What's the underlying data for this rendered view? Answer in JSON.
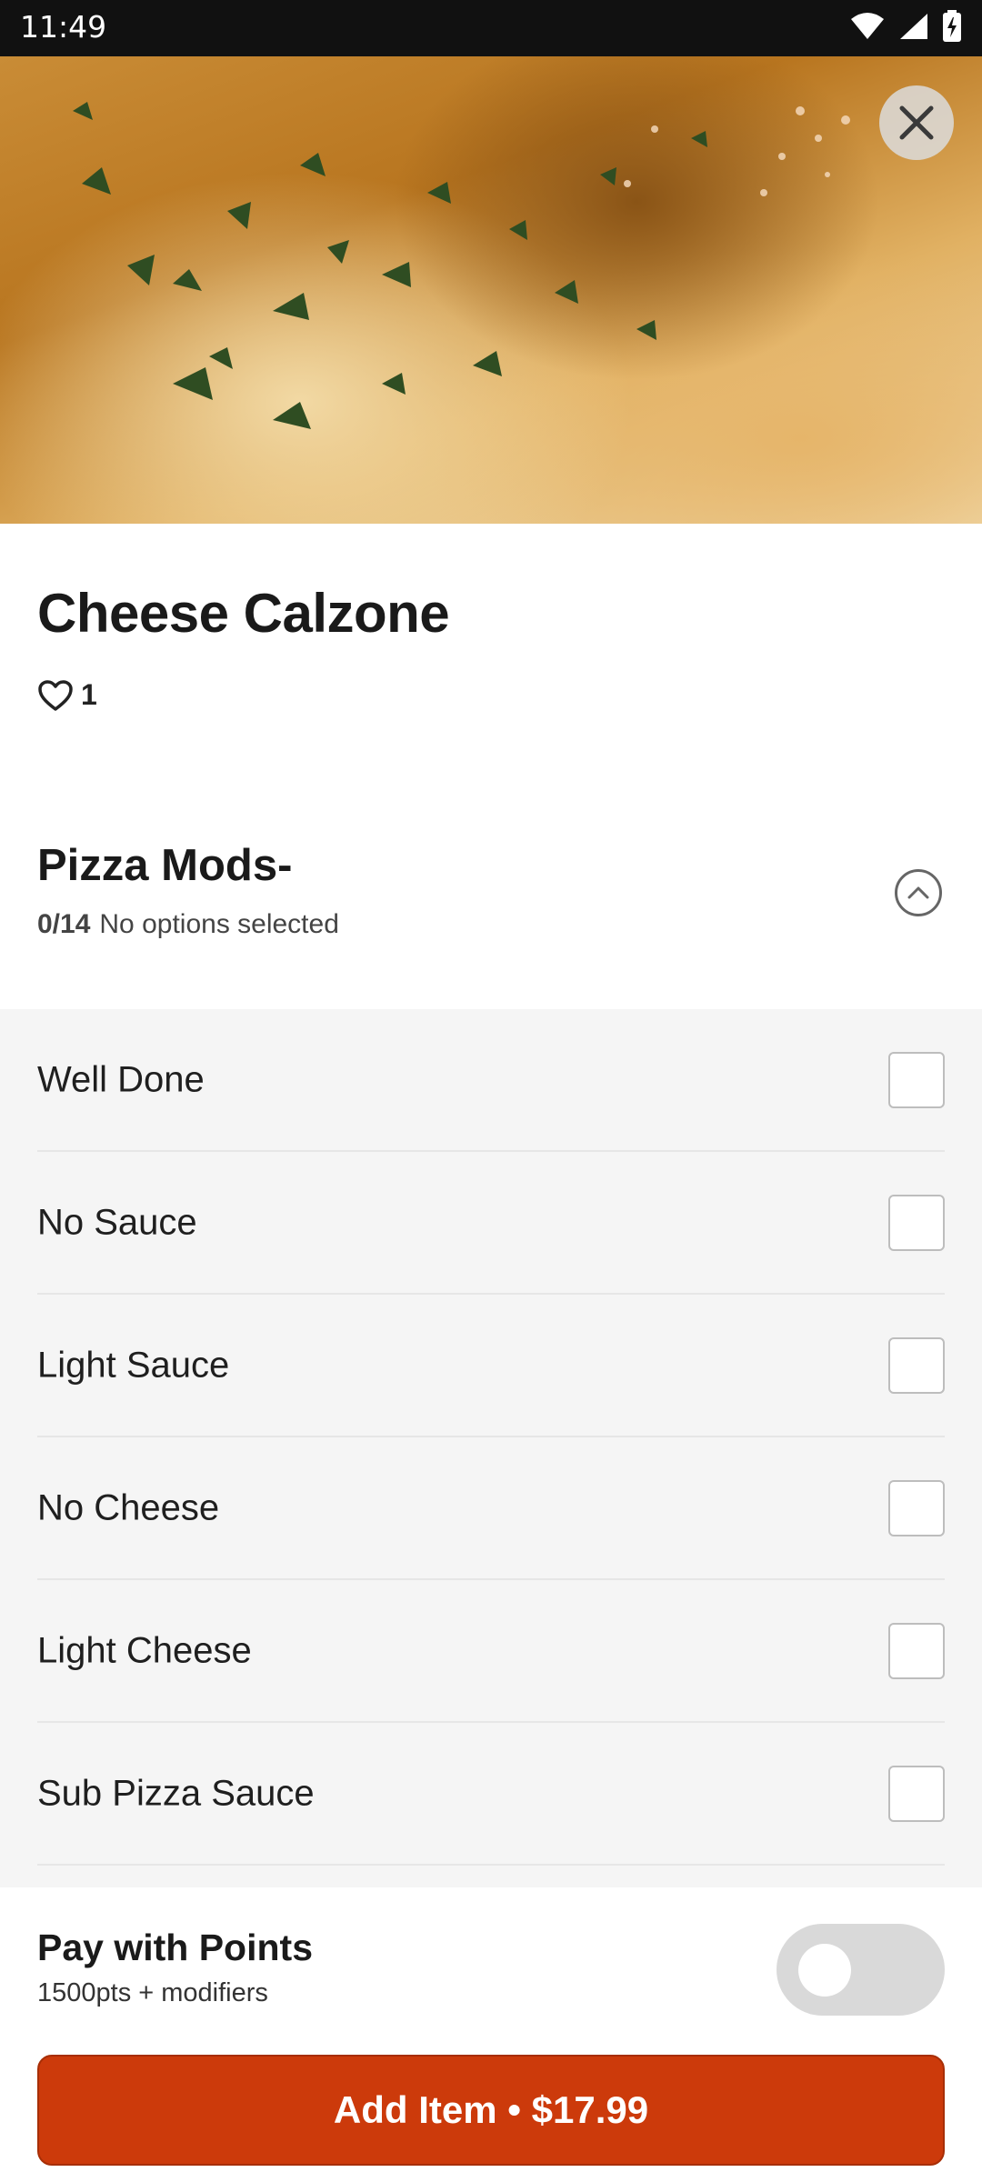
{
  "status_bar": {
    "time": "11:49",
    "icons": [
      "wifi-icon",
      "signal-icon",
      "battery-icon"
    ]
  },
  "hero": {
    "image": "calzone-photo",
    "close_icon": "close-icon"
  },
  "item": {
    "title": "Cheese Calzone",
    "likes_icon": "heart-outline-icon",
    "likes_count": "1"
  },
  "modifier_group": {
    "title": "Pizza Mods-",
    "selected_count": "0/14",
    "selected_text": "No options selected",
    "collapse_icon": "chevron-up-circle-icon",
    "options": [
      {
        "label": "Well Done",
        "checked": false
      },
      {
        "label": "No Sauce",
        "checked": false
      },
      {
        "label": "Light Sauce",
        "checked": false
      },
      {
        "label": "No Cheese",
        "checked": false
      },
      {
        "label": "Light Cheese",
        "checked": false
      },
      {
        "label": "Sub Pizza Sauce",
        "checked": false
      }
    ]
  },
  "bottom_bar": {
    "points_title": "Pay with Points",
    "points_sub": "1500pts + modifiers",
    "points_toggle_on": false,
    "add_button_label": "Add Item • $17.99"
  },
  "colors": {
    "accent": "#cc3a0b",
    "options_background": "#f5f5f5",
    "toggle_off": "#d9d9d9"
  }
}
